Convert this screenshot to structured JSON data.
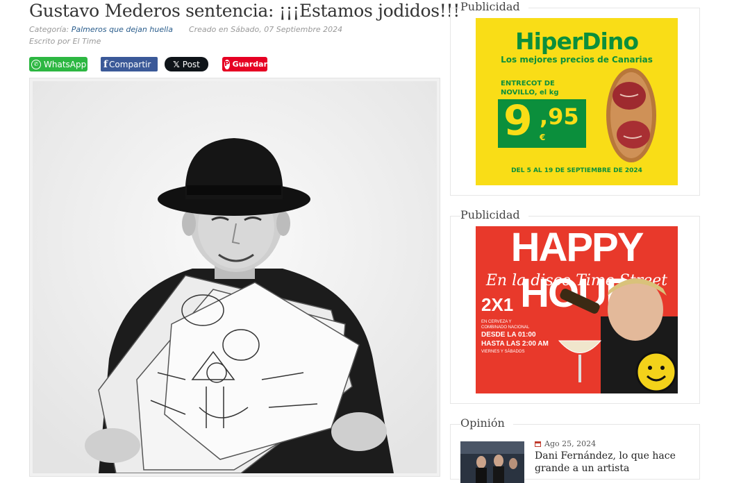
{
  "article": {
    "title": "Gustavo Mederos sentencia: ¡¡¡Estamos jodidos!!!",
    "category_label": "Categoría:",
    "category": "Palmeros que dejan huella",
    "created": "Creado en Sábado, 07 Septiembre 2024",
    "author": "Escrito por El Time"
  },
  "share": {
    "whatsapp": "WhatsApp",
    "facebook": "Compartir",
    "x": "Post",
    "pinterest": "Guardar"
  },
  "sidebar": {
    "ad_heading_1": "Publicidad",
    "ad_heading_2": "Publicidad",
    "opinion_heading": "Opinión",
    "hiperdino": {
      "brand": "HiperDino",
      "tagline": "Los mejores precios de Canarias",
      "product": "ENTRECOT DE\nNOVILLO, el kg",
      "price_int": "9",
      "price_dec": ",95",
      "currency": "€",
      "dates": "DEL 5 AL 19 DE SEPTIEMBRE DE 2024"
    },
    "happyhour": {
      "title": "HAPPY HOUR",
      "subtitle": "En la disco Time Street",
      "promo": "2X1",
      "promo_detail": "EN CERVEZA Y\nCOMBINADO NACIONAL",
      "hours": "DESDE LA 01:00\nHASTA LAS 2:00 AM",
      "days": "VIERNES Y SÁBADOS"
    },
    "opinion": {
      "date": "Ago 25, 2024",
      "title": "Dani Fernández, lo que hace grande a un artista"
    }
  },
  "colors": {
    "whatsapp": "#2db742",
    "facebook": "#3b5998",
    "x": "#0f1419",
    "pinterest": "#e60023",
    "link": "#2a5d8c",
    "hiperdino_yellow": "#f9dd17",
    "hiperdino_green": "#0b8f3c",
    "happyhour_red": "#e8392b"
  }
}
